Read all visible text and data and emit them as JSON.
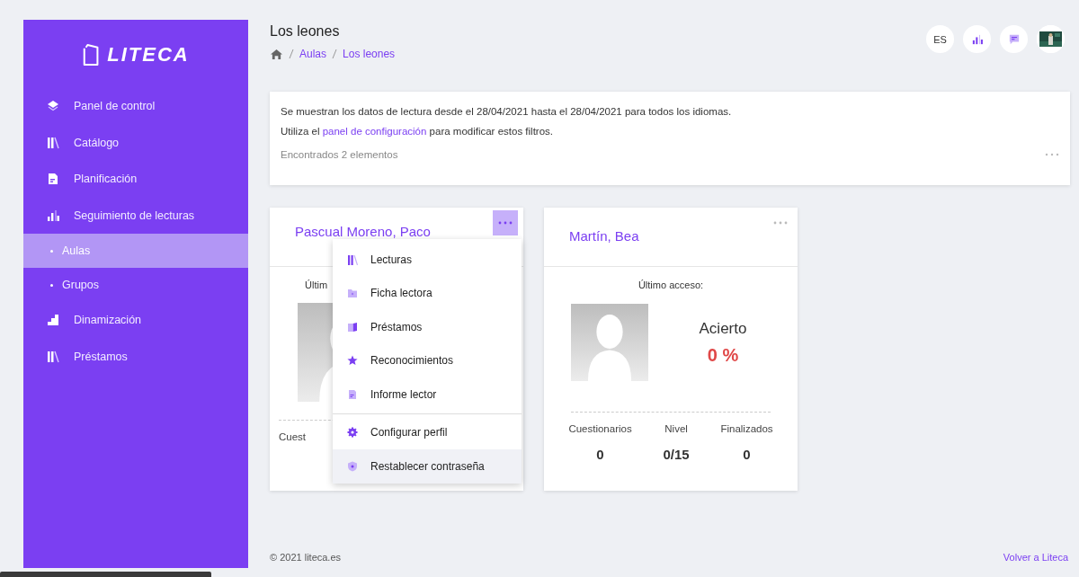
{
  "sidebar": {
    "logo": "LITECA",
    "items": [
      {
        "label": "Panel de control",
        "kind": "item",
        "selected": false
      },
      {
        "label": "Catálogo",
        "kind": "item",
        "selected": false
      },
      {
        "label": "Planificación",
        "kind": "item",
        "selected": false
      },
      {
        "label": "Seguimiento de lecturas",
        "kind": "item",
        "selected": false
      },
      {
        "label": "Aulas",
        "kind": "subitem",
        "selected": true
      },
      {
        "label": "Grupos",
        "kind": "subitem",
        "selected": false
      },
      {
        "label": "Dinamización",
        "kind": "item",
        "selected": false
      },
      {
        "label": "Préstamos",
        "kind": "item",
        "selected": false
      }
    ]
  },
  "header": {
    "title": "Los leones",
    "breadcrumb": [
      "Aulas",
      "Los leones"
    ],
    "language": "ES"
  },
  "info": {
    "line_1": "Se muestran los datos de lectura desde el 28/04/2021 hasta el 28/04/2021 para todos los idiomas.",
    "line_2_before": "Utiliza el",
    "line_2_link": "panel de configuración",
    "line_2_after": "para modificar estos filtros.",
    "count": "Encontrados 2 elementos"
  },
  "students": [
    {
      "name": "Pascual Moreno, Paco",
      "menu_open": true,
      "last_access": "Últim",
      "stats": [
        {
          "label": "Cuest"
        }
      ]
    },
    {
      "name": "Martín, Bea",
      "menu_open": false,
      "last_access": "Último acceso:",
      "score_label": "Acierto",
      "score": "0 %",
      "stats": [
        {
          "label": "Cuestionarios",
          "value": "0"
        },
        {
          "label": "Nivel",
          "value": "0/15"
        },
        {
          "label": "Finalizados",
          "value": "0"
        }
      ]
    }
  ],
  "menu": {
    "items": [
      {
        "label": "Lecturas",
        "highlighted": false,
        "divider_before": false
      },
      {
        "label": "Ficha lectora",
        "highlighted": false,
        "divider_before": false
      },
      {
        "label": "Préstamos",
        "highlighted": false,
        "divider_before": false
      },
      {
        "label": "Reconocimientos",
        "highlighted": false,
        "divider_before": false
      },
      {
        "label": "Informe lector",
        "highlighted": false,
        "divider_before": false
      },
      {
        "label": "Configurar perfil",
        "highlighted": false,
        "divider_before": true
      },
      {
        "label": "Restablecer contraseña",
        "highlighted": true,
        "divider_before": false
      }
    ]
  },
  "footer": {
    "copyright": "© 2021 liteca.es",
    "link": "Volver a Liteca"
  }
}
